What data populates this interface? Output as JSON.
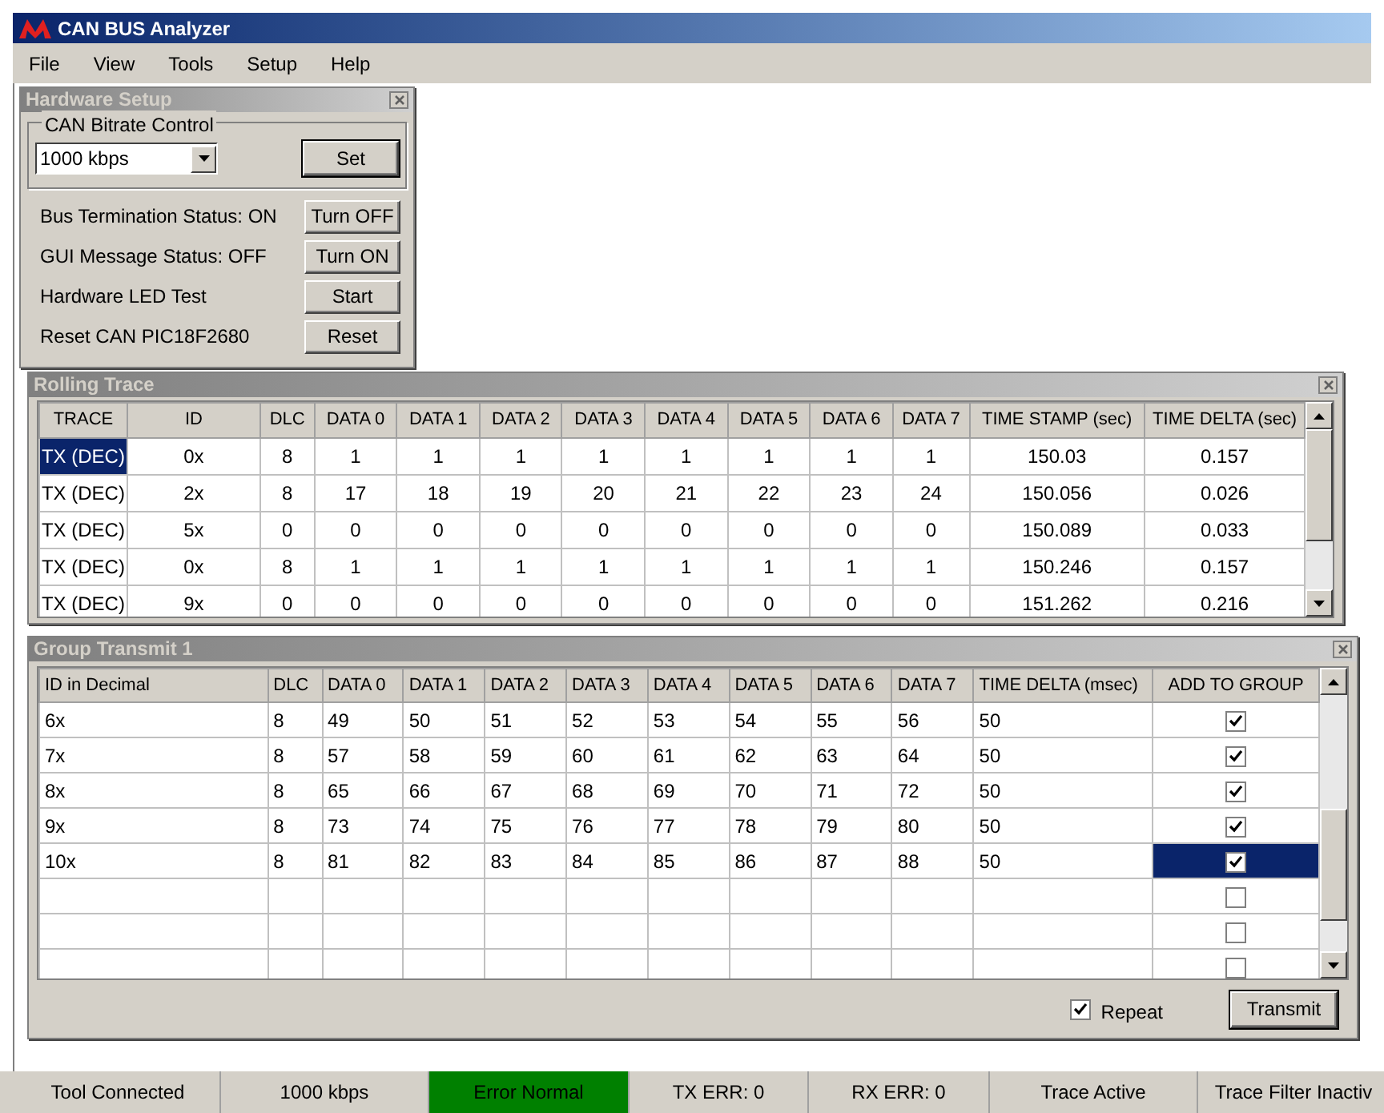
{
  "window": {
    "title": "CAN BUS Analyzer"
  },
  "menu": [
    "File",
    "View",
    "Tools",
    "Setup",
    "Help"
  ],
  "hardware_setup": {
    "title": "Hardware Setup",
    "group_label": "CAN Bitrate Control",
    "bitrate": "1000 kbps",
    "set_button": "Set",
    "rows": [
      {
        "label": "Bus Termination Status: ON",
        "button": "Turn OFF"
      },
      {
        "label": "GUI Message Status: OFF",
        "button": "Turn ON"
      },
      {
        "label": "Hardware LED Test",
        "button": "Start"
      },
      {
        "label": "Reset CAN PIC18F2680",
        "button": "Reset"
      }
    ]
  },
  "rolling_trace": {
    "title": "Rolling Trace",
    "columns": [
      "TRACE",
      "ID",
      "DLC",
      "DATA 0",
      "DATA 1",
      "DATA 2",
      "DATA 3",
      "DATA 4",
      "DATA 5",
      "DATA 6",
      "DATA 7",
      "TIME STAMP (sec)",
      "TIME DELTA (sec)"
    ],
    "rows": [
      {
        "selected": true,
        "cells": [
          "TX (DEC)",
          "0x",
          "8",
          "1",
          "1",
          "1",
          "1",
          "1",
          "1",
          "1",
          "1",
          "150.03",
          "0.157"
        ]
      },
      {
        "selected": false,
        "cells": [
          "TX (DEC)",
          "2x",
          "8",
          "17",
          "18",
          "19",
          "20",
          "21",
          "22",
          "23",
          "24",
          "150.056",
          "0.026"
        ]
      },
      {
        "selected": false,
        "cells": [
          "TX (DEC)",
          "5x",
          "0",
          "0",
          "0",
          "0",
          "0",
          "0",
          "0",
          "0",
          "0",
          "150.089",
          "0.033"
        ]
      },
      {
        "selected": false,
        "cells": [
          "TX (DEC)",
          "0x",
          "8",
          "1",
          "1",
          "1",
          "1",
          "1",
          "1",
          "1",
          "1",
          "150.246",
          "0.157"
        ]
      },
      {
        "selected": false,
        "cells": [
          "TX (DEC)",
          "9x",
          "0",
          "0",
          "0",
          "0",
          "0",
          "0",
          "0",
          "0",
          "0",
          "151.262",
          "0.216"
        ]
      }
    ]
  },
  "group_transmit": {
    "title": "Group Transmit 1",
    "columns": [
      "ID in Decimal",
      "DLC",
      "DATA 0",
      "DATA 1",
      "DATA 2",
      "DATA 3",
      "DATA 4",
      "DATA 5",
      "DATA 6",
      "DATA 7",
      "TIME DELTA (msec)",
      "ADD TO GROUP"
    ],
    "rows": [
      {
        "selected": false,
        "checked": true,
        "cells": [
          "6x",
          "8",
          "49",
          "50",
          "51",
          "52",
          "53",
          "54",
          "55",
          "56",
          "50"
        ]
      },
      {
        "selected": false,
        "checked": true,
        "cells": [
          "7x",
          "8",
          "57",
          "58",
          "59",
          "60",
          "61",
          "62",
          "63",
          "64",
          "50"
        ]
      },
      {
        "selected": false,
        "checked": true,
        "cells": [
          "8x",
          "8",
          "65",
          "66",
          "67",
          "68",
          "69",
          "70",
          "71",
          "72",
          "50"
        ]
      },
      {
        "selected": false,
        "checked": true,
        "cells": [
          "9x",
          "8",
          "73",
          "74",
          "75",
          "76",
          "77",
          "78",
          "79",
          "80",
          "50"
        ]
      },
      {
        "selected": true,
        "checked": true,
        "cells": [
          "10x",
          "8",
          "81",
          "82",
          "83",
          "84",
          "85",
          "86",
          "87",
          "88",
          "50"
        ]
      },
      {
        "selected": false,
        "checked": false,
        "cells": []
      },
      {
        "selected": false,
        "checked": false,
        "cells": []
      },
      {
        "selected": false,
        "checked": false,
        "cells": []
      }
    ],
    "repeat": {
      "label": "Repeat",
      "checked": true
    },
    "transmit_button": "Transmit"
  },
  "status_bar": [
    {
      "text": "Tool Connected"
    },
    {
      "text": "1000 kbps"
    },
    {
      "text": "Error Normal",
      "color": "#008000"
    },
    {
      "text": "TX ERR: 0"
    },
    {
      "text": "RX ERR: 0"
    },
    {
      "text": "Trace Active"
    },
    {
      "text": "Trace Filter Inactiv"
    }
  ]
}
